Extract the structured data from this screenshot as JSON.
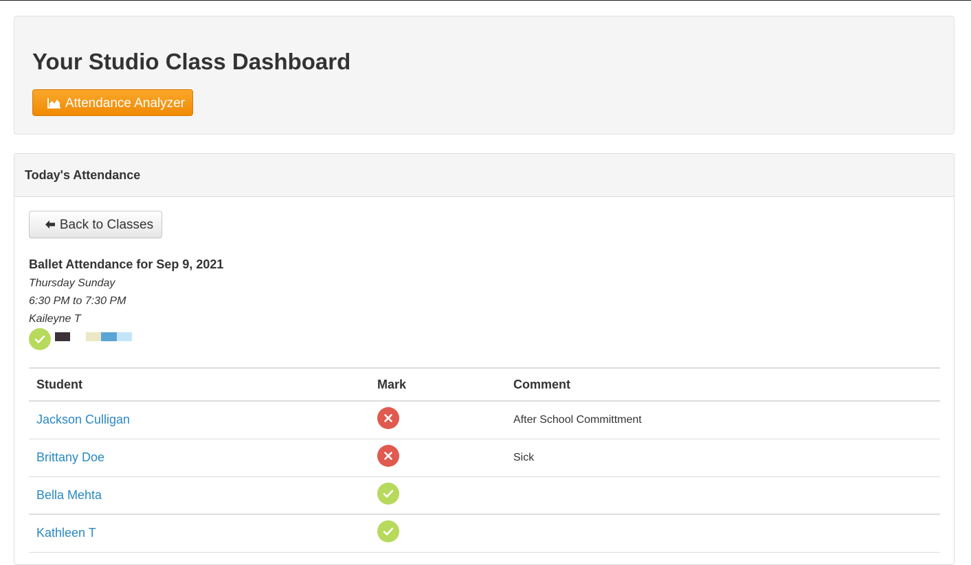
{
  "header": {
    "title": "Your Studio Class Dashboard",
    "analyzer_button": "Attendance Analyzer"
  },
  "panel": {
    "heading": "Today's Attendance",
    "back_button": "Back to Classes"
  },
  "class_info": {
    "title": "Ballet Attendance for Sep 9, 2021",
    "days": "Thursday Sunday",
    "time": "6:30 PM to 7:30 PM",
    "teacher": "Kaileyne T",
    "status_icon": "check-circle-icon",
    "swatch_colors": [
      "#3d3239",
      "#ebe8c5",
      "#5ba4d6",
      "#c3e5f7"
    ]
  },
  "table": {
    "headers": {
      "student": "Student",
      "mark": "Mark",
      "comment": "Comment"
    },
    "rows": [
      {
        "student": "Jackson Culligan",
        "mark": "absent",
        "comment": "After School Committment"
      },
      {
        "student": "Brittany Doe",
        "mark": "absent",
        "comment": "Sick"
      },
      {
        "student": "Bella Mehta",
        "mark": "present",
        "comment": ""
      },
      {
        "student": "Kathleen T",
        "mark": "present",
        "comment": ""
      }
    ]
  },
  "colors": {
    "present": "#b7d95c",
    "absent": "#e05a4f",
    "link": "#2a88c2",
    "accent": "#f39c12"
  }
}
